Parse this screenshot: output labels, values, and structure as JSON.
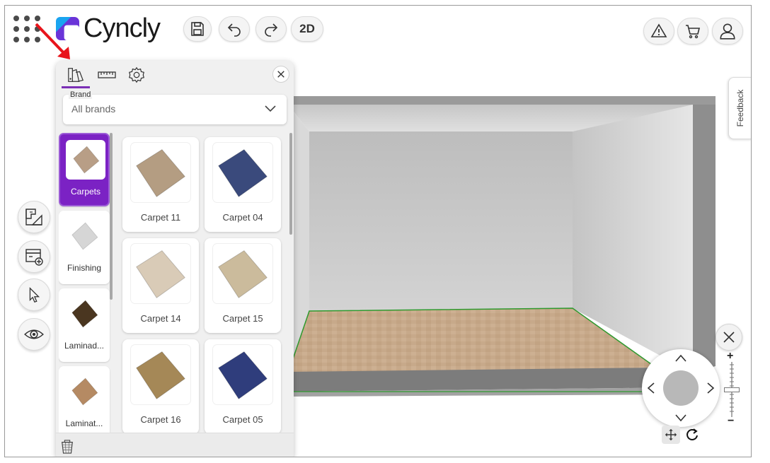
{
  "app": {
    "logo_text": "Cyncly",
    "logo_colors": [
      "#1aa4f0",
      "#6a34d8",
      "#ff3b5c"
    ],
    "accent": "#7b22c4"
  },
  "toolbar": {
    "apps_icon": "grid-dots-icon",
    "save_icon": "save-icon",
    "undo_icon": "undo-icon",
    "redo_icon": "redo-icon",
    "view_mode_label": "2D",
    "warning_icon": "warning-icon",
    "cart_icon": "cart-icon",
    "user_icon": "user-icon"
  },
  "left_tools": [
    "floor-plan-icon",
    "furniture-add-icon",
    "pointer-icon",
    "eye-icon"
  ],
  "panel": {
    "tabs": [
      "swatches-icon",
      "ruler-icon",
      "gear-icon"
    ],
    "active_tab": 0,
    "brand": {
      "label": "Brand",
      "value": "All brands"
    },
    "categories": [
      {
        "label": "Carpets",
        "active": true,
        "swatch": "#b89e86"
      },
      {
        "label": "Finishing",
        "active": false,
        "swatch": "#d6d6d6"
      },
      {
        "label": "Laminad...",
        "active": false,
        "swatch": "#4a3620"
      },
      {
        "label": "Laminat...",
        "active": false,
        "swatch": "#b58a63"
      }
    ],
    "products": [
      {
        "label": "Carpet 11",
        "color": "#b49d82"
      },
      {
        "label": "Carpet 04",
        "color": "#3a4a7c"
      },
      {
        "label": "Carpet 14",
        "color": "#d9cbb7"
      },
      {
        "label": "Carpet 15",
        "color": "#cbbb9c"
      },
      {
        "label": "Carpet 16",
        "color": "#a58857"
      },
      {
        "label": "Carpet 05",
        "color": "#2f3d7c"
      }
    ],
    "footer_icon": "trash-icon"
  },
  "right": {
    "feedback_label": "Feedback",
    "close_icon": "close-icon",
    "nav_icons": [
      "chevron-up-icon",
      "chevron-left-icon",
      "chevron-right-icon",
      "chevron-down-icon"
    ],
    "mode_icons": [
      "move-icon",
      "rotate-icon"
    ],
    "zoom_plus": "+",
    "zoom_minus": "−",
    "zoom_level": 0.5
  },
  "annotation": {
    "color": "#e8141b"
  }
}
